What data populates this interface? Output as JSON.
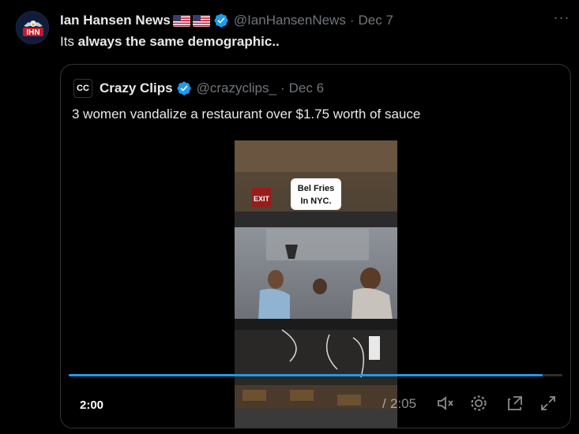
{
  "tweet": {
    "author_name": "Ian Hansen News",
    "handle": "@IanHansenNews",
    "separator": "·",
    "date": "Dec 7",
    "text_prefix": "Its ",
    "text_bold": "always the same demographic..",
    "more_label": "···",
    "avatar_text": "IHN"
  },
  "quote": {
    "avatar_text": "CC",
    "author_name": "Crazy Clips",
    "handle": "@crazyclips_",
    "separator": "·",
    "date": "Dec 6",
    "text": "3 women vandalize a restaurant over $1.75 worth of sauce"
  },
  "video": {
    "overlay_text_line1": "Bel Fries",
    "overlay_text_line2": "In NYC.",
    "exit_sign": "EXIT",
    "current_time": "2:00",
    "time_separator": "/",
    "total_time": "2:05",
    "progress_fraction": 0.96,
    "icons": [
      "mute-icon",
      "settings-icon",
      "picture-in-picture-icon",
      "fullscreen-icon"
    ]
  },
  "colors": {
    "background": "#000000",
    "text": "#e7e9ea",
    "secondary": "#71767b",
    "verified": "#1d9bf0",
    "border": "#2f3336"
  }
}
